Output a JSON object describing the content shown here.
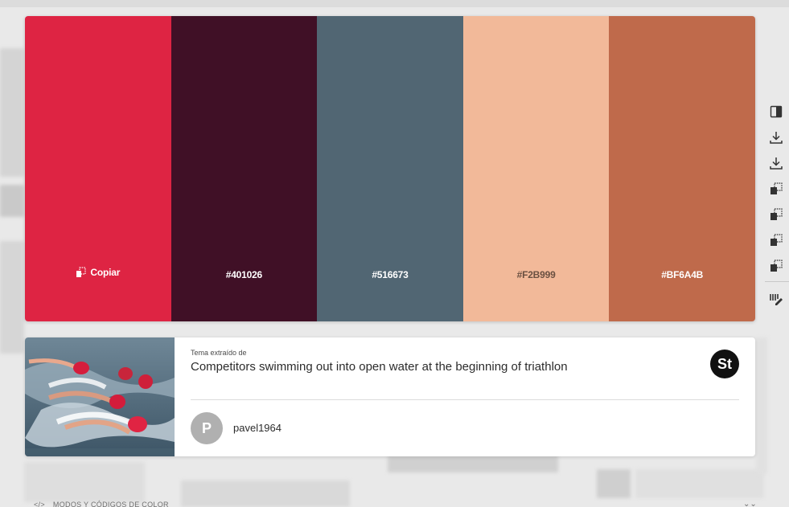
{
  "palette": {
    "swatches": [
      {
        "hex": "#DE2443",
        "label": "Copiar",
        "text_color": "#ffffff",
        "hovered": true
      },
      {
        "hex": "#401026",
        "label": "#401026",
        "text_color": "#ffffff",
        "hovered": false
      },
      {
        "hex": "#516673",
        "label": "#516673",
        "text_color": "#ffffff",
        "hovered": false
      },
      {
        "hex": "#F2B999",
        "label": "#F2B999",
        "text_color": "#6a5041",
        "hovered": false
      },
      {
        "hex": "#BF6A4B",
        "label": "#BF6A4B",
        "text_color": "#ffffff",
        "hovered": false
      }
    ]
  },
  "toolbar": {
    "icons": [
      "copy-panel-icon",
      "download-icon",
      "download-icon",
      "copy-swatches-icon",
      "copy-swatches-icon",
      "copy-swatches-icon",
      "copy-swatches-icon",
      "edit-palette-icon"
    ]
  },
  "card": {
    "extracted_label": "Tema extraído de",
    "title": "Competitors swimming out into open water at the beginning of triathlon",
    "badge": "St",
    "avatar_letter": "P",
    "author": "pavel1964"
  },
  "bottom": {
    "section_label": "MODOS Y CÓDIGOS DE COLOR",
    "code_icon": "</>"
  }
}
